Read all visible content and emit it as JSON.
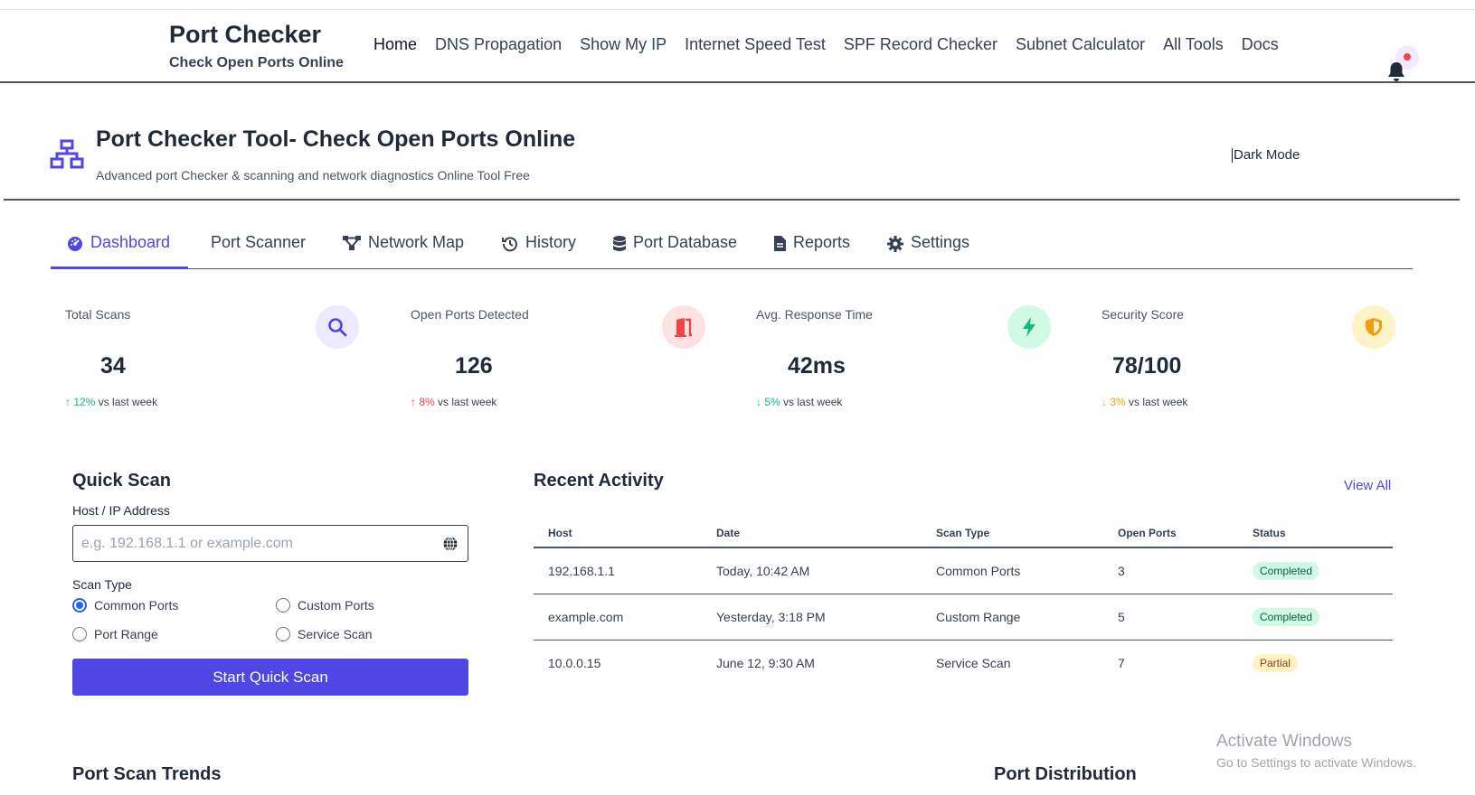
{
  "header": {
    "brand_title": "Port Checker",
    "brand_subtitle": "Check Open Ports Online",
    "nav": [
      "Home",
      "DNS Propagation",
      "Show My IP",
      "Internet Speed Test",
      "SPF Record Checker",
      "Subnet Calculator",
      "All Tools",
      "Docs"
    ]
  },
  "tool": {
    "icon": "network-icon",
    "title": "Port Checker Tool- Check Open Ports Online",
    "subtitle": "Advanced port Checker & scanning and network diagnostics Online Tool Free",
    "dark_mode_label": "Dark Mode",
    "notification_icon": "bell-icon"
  },
  "tabs": [
    {
      "label": "Dashboard",
      "icon": "dashboard-icon",
      "active": true
    },
    {
      "label": "Port Scanner",
      "icon": "",
      "active": false
    },
    {
      "label": "Network Map",
      "icon": "network-map-icon",
      "active": false
    },
    {
      "label": "History",
      "icon": "history-icon",
      "active": false
    },
    {
      "label": "Port Database",
      "icon": "database-icon",
      "active": false
    },
    {
      "label": "Reports",
      "icon": "report-icon",
      "active": false
    },
    {
      "label": "Settings",
      "icon": "gear-icon",
      "active": false
    }
  ],
  "stats": [
    {
      "label": "Total Scans",
      "value": "34",
      "change_pct": "12%",
      "change_text": "vs last week",
      "direction": "up",
      "change_color": "#10b981",
      "icon": "search-icon",
      "icon_bg": "#ede9fe",
      "icon_color": "#4f46e5"
    },
    {
      "label": "Open Ports Detected",
      "value": "126",
      "change_pct": "8%",
      "change_text": "vs last week",
      "direction": "up",
      "change_color": "#ef4444",
      "icon": "door-open-icon",
      "icon_bg": "#fee2e2",
      "icon_color": "#ef4444"
    },
    {
      "label": "Avg. Response Time",
      "value": "42ms",
      "change_pct": "5%",
      "change_text": "vs last week",
      "direction": "down",
      "change_color": "#10b981",
      "icon": "bolt-icon",
      "icon_bg": "#d1fae5",
      "icon_color": "#10b981"
    },
    {
      "label": "Security Score",
      "value": "78/100",
      "change_pct": "3%",
      "change_text": "vs last week",
      "direction": "down",
      "change_color": "#f59e0b",
      "icon": "shield-icon",
      "icon_bg": "#fef3c7",
      "icon_color": "#f59e0b"
    }
  ],
  "quick_scan": {
    "title": "Quick Scan",
    "host_label": "Host / IP Address",
    "host_value": "",
    "host_placeholder": "e.g. 192.168.1.1 or example.com",
    "scan_type_label": "Scan Type",
    "options": [
      {
        "label": "Common Ports",
        "checked": true
      },
      {
        "label": "Custom Ports",
        "checked": false
      },
      {
        "label": "Port Range",
        "checked": false
      },
      {
        "label": "Service Scan",
        "checked": false
      }
    ],
    "button_label": "Start Quick Scan"
  },
  "recent_activity": {
    "title": "Recent Activity",
    "view_all": "View All",
    "columns": [
      "Host",
      "Date",
      "Scan Type",
      "Open Ports",
      "Status"
    ],
    "rows": [
      {
        "host": "192.168.1.1",
        "date": "Today, 10:42 AM",
        "scan_type": "Common Ports",
        "open_ports": "3",
        "status": "Completed"
      },
      {
        "host": "example.com",
        "date": "Yesterday, 3:18 PM",
        "scan_type": "Custom Range",
        "open_ports": "5",
        "status": "Completed"
      },
      {
        "host": "10.0.0.15",
        "date": "June 12, 9:30 AM",
        "scan_type": "Service Scan",
        "open_ports": "7",
        "status": "Partial"
      }
    ]
  },
  "sections": {
    "trends_title": "Port Scan Trends",
    "distribution_title": "Port Distribution"
  },
  "watermark": {
    "title": "Activate Windows",
    "subtitle": "Go to Settings to activate Windows."
  },
  "colors": {
    "accent": "#4f46e5",
    "badge_completed": "#d1fae5",
    "badge_partial": "#fef3c7"
  }
}
